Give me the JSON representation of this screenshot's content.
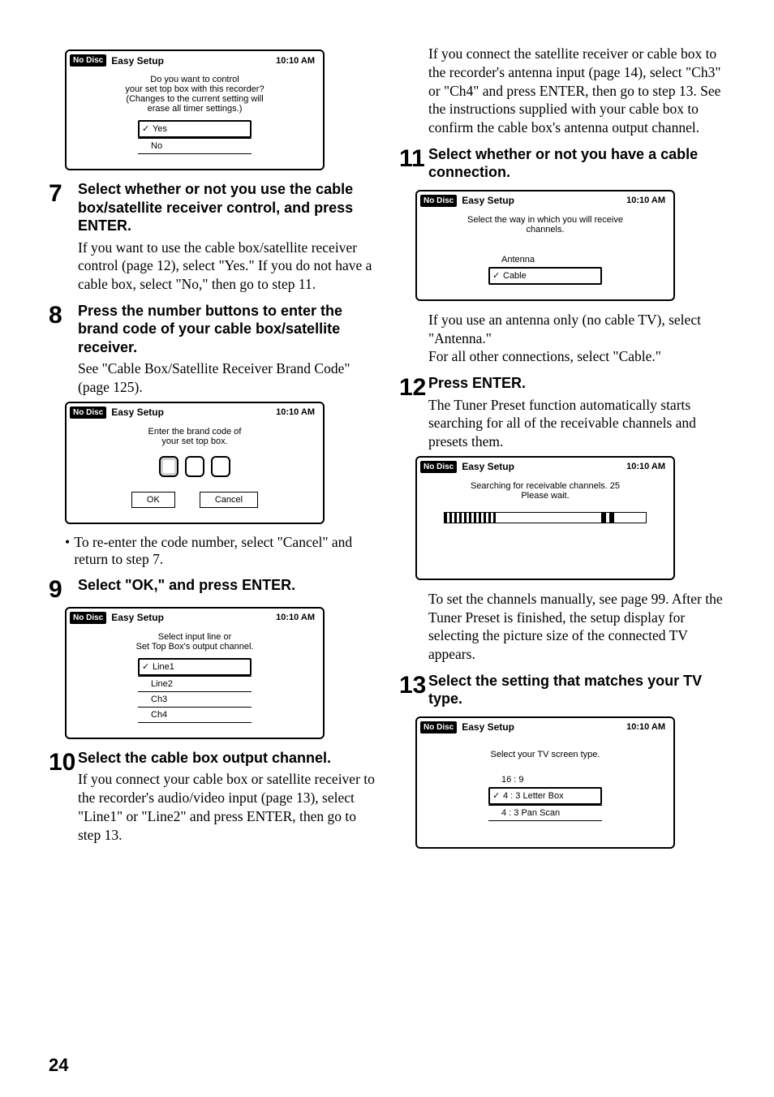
{
  "page_number": "24",
  "dialogs": {
    "d1": {
      "nodisc": "No Disc",
      "title": "Easy Setup",
      "time": "10:10 AM",
      "msg_l1": "Do you want to control",
      "msg_l2": "your set top box with this recorder?",
      "msg_l3": "(Changes to the current setting will",
      "msg_l4": "erase all timer settings.)",
      "opt1": "Yes",
      "opt2": "No"
    },
    "d2": {
      "nodisc": "No Disc",
      "title": "Easy Setup",
      "time": "10:10 AM",
      "msg_l1": "Enter the brand code of",
      "msg_l2": "your set top box.",
      "btn_ok": "OK",
      "btn_cancel": "Cancel"
    },
    "d3": {
      "nodisc": "No Disc",
      "title": "Easy Setup",
      "time": "10:10 AM",
      "msg_l1": "Select input line or",
      "msg_l2": "Set Top Box's output channel.",
      "opt1": "Line1",
      "opt2": "Line2",
      "opt3": "Ch3",
      "opt4": "Ch4"
    },
    "d4": {
      "nodisc": "No Disc",
      "title": "Easy Setup",
      "time": "10:10 AM",
      "msg_l1": "Select the way in which you will receive",
      "msg_l2": "channels.",
      "opt1": "Antenna",
      "opt2": "Cable"
    },
    "d5": {
      "nodisc": "No Disc",
      "title": "Easy Setup",
      "time": "10:10 AM",
      "msg_l1": "Searching for receivable channels. 25",
      "msg_l2": "Please wait."
    },
    "d6": {
      "nodisc": "No Disc",
      "title": "Easy Setup",
      "time": "10:10 AM",
      "msg_l1": "Select your TV screen type.",
      "opt1": "16 : 9",
      "opt2": "4 : 3  Letter Box",
      "opt3": "4 : 3  Pan Scan"
    }
  },
  "steps": {
    "s7": {
      "num": "7",
      "head": "Select whether or not you use the cable box/satellite receiver control, and press ENTER.",
      "body": "If you want to use the cable box/satellite receiver control (page 12), select \"Yes.\" If you do not have a cable box, select \"No,\" then go to step 11."
    },
    "s8": {
      "num": "8",
      "head": "Press the number buttons to enter the brand code of your cable box/satellite receiver.",
      "body": "See \"Cable Box/Satellite Receiver Brand Code\" (page 125)."
    },
    "s8_bullet": "To re-enter the code number, select \"Cancel\" and return to step 7.",
    "s9": {
      "num": "9",
      "head": "Select \"OK,\" and press ENTER."
    },
    "s10": {
      "num": "10",
      "head": "Select the cable box output channel.",
      "body": "If you connect your cable box or satellite receiver to the recorder's audio/video input (page 13), select \"Line1\" or \"Line2\" and press ENTER, then go to step 13."
    },
    "s10b": "If you connect the satellite receiver or cable box to the recorder's antenna input (page 14), select \"Ch3\" or \"Ch4\" and press ENTER, then go to step 13. See the instructions supplied with your cable box to confirm the cable box's antenna output channel.",
    "s11": {
      "num": "11",
      "head": "Select whether or not you have a cable connection.",
      "body": "If you use an antenna only (no cable TV), select \"Antenna.\"\nFor all other connections, select \"Cable.\""
    },
    "s12": {
      "num": "12",
      "head": "Press ENTER.",
      "body": "The Tuner Preset function automatically starts searching for all of the receivable channels and presets them.",
      "body2": "To set the channels manually, see page 99. After the Tuner Preset is finished, the setup display for selecting the picture size of the connected TV appears."
    },
    "s13": {
      "num": "13",
      "head": "Select the setting that matches your TV type."
    }
  }
}
